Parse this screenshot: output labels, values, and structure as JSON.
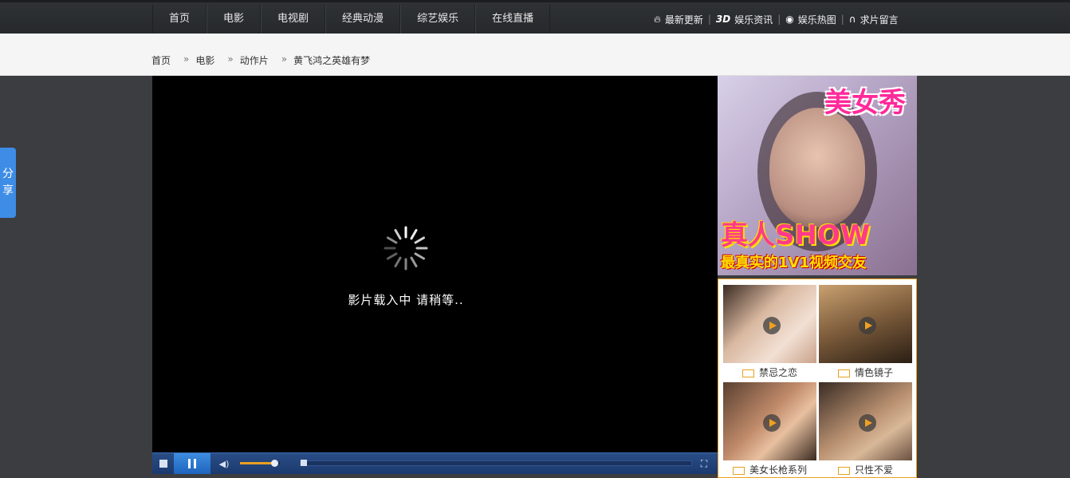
{
  "nav": {
    "items": [
      "首页",
      "电影",
      "电视剧",
      "经典动漫",
      "综艺娱乐",
      "在线直播"
    ]
  },
  "toplinks": [
    {
      "icon": "flame-icon",
      "label": "最新更新"
    },
    {
      "icon": "3d-icon",
      "icon_text": "3D",
      "label": "娱乐资讯"
    },
    {
      "icon": "eye-icon",
      "label": "娱乐热图"
    },
    {
      "icon": "headphones-icon",
      "label": "求片留言"
    }
  ],
  "breadcrumb": [
    "首页",
    "电影",
    "动作片",
    "黄飞鸿之英雄有梦"
  ],
  "share": {
    "label": "分享"
  },
  "player": {
    "loading_text": "影片载入中 请稍等..",
    "volume_level": 0.85,
    "progress": 0.0
  },
  "ad_top": {
    "title": "美女秀",
    "headline": "真人SHOW",
    "tagline": "最真实的1V1视频交友"
  },
  "ad_grid": [
    {
      "caption": "禁忌之恋"
    },
    {
      "caption": "情色镜子"
    },
    {
      "caption": "美女长枪系列"
    },
    {
      "caption": "只性不爱"
    }
  ],
  "colors": {
    "accent": "#3d8ce6",
    "ad_border": "#f0a020",
    "player_bar": "#1b3a6e"
  }
}
